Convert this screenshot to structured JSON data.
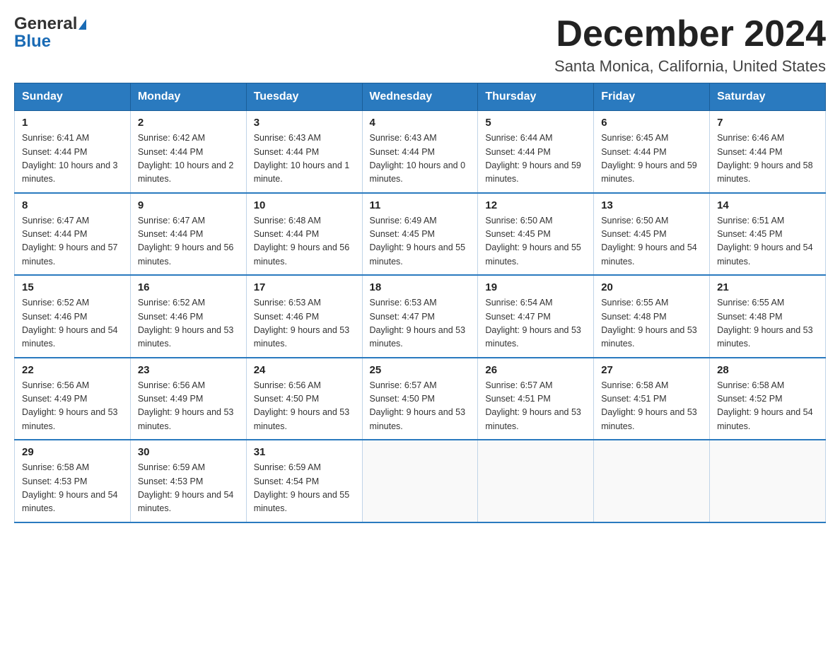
{
  "header": {
    "logo_line1": "General",
    "logo_line2": "Blue",
    "title": "December 2024",
    "subtitle": "Santa Monica, California, United States"
  },
  "days_of_week": [
    "Sunday",
    "Monday",
    "Tuesday",
    "Wednesday",
    "Thursday",
    "Friday",
    "Saturday"
  ],
  "weeks": [
    [
      {
        "day": "1",
        "sunrise": "6:41 AM",
        "sunset": "4:44 PM",
        "daylight": "10 hours and 3 minutes."
      },
      {
        "day": "2",
        "sunrise": "6:42 AM",
        "sunset": "4:44 PM",
        "daylight": "10 hours and 2 minutes."
      },
      {
        "day": "3",
        "sunrise": "6:43 AM",
        "sunset": "4:44 PM",
        "daylight": "10 hours and 1 minute."
      },
      {
        "day": "4",
        "sunrise": "6:43 AM",
        "sunset": "4:44 PM",
        "daylight": "10 hours and 0 minutes."
      },
      {
        "day": "5",
        "sunrise": "6:44 AM",
        "sunset": "4:44 PM",
        "daylight": "9 hours and 59 minutes."
      },
      {
        "day": "6",
        "sunrise": "6:45 AM",
        "sunset": "4:44 PM",
        "daylight": "9 hours and 59 minutes."
      },
      {
        "day": "7",
        "sunrise": "6:46 AM",
        "sunset": "4:44 PM",
        "daylight": "9 hours and 58 minutes."
      }
    ],
    [
      {
        "day": "8",
        "sunrise": "6:47 AM",
        "sunset": "4:44 PM",
        "daylight": "9 hours and 57 minutes."
      },
      {
        "day": "9",
        "sunrise": "6:47 AM",
        "sunset": "4:44 PM",
        "daylight": "9 hours and 56 minutes."
      },
      {
        "day": "10",
        "sunrise": "6:48 AM",
        "sunset": "4:44 PM",
        "daylight": "9 hours and 56 minutes."
      },
      {
        "day": "11",
        "sunrise": "6:49 AM",
        "sunset": "4:45 PM",
        "daylight": "9 hours and 55 minutes."
      },
      {
        "day": "12",
        "sunrise": "6:50 AM",
        "sunset": "4:45 PM",
        "daylight": "9 hours and 55 minutes."
      },
      {
        "day": "13",
        "sunrise": "6:50 AM",
        "sunset": "4:45 PM",
        "daylight": "9 hours and 54 minutes."
      },
      {
        "day": "14",
        "sunrise": "6:51 AM",
        "sunset": "4:45 PM",
        "daylight": "9 hours and 54 minutes."
      }
    ],
    [
      {
        "day": "15",
        "sunrise": "6:52 AM",
        "sunset": "4:46 PM",
        "daylight": "9 hours and 54 minutes."
      },
      {
        "day": "16",
        "sunrise": "6:52 AM",
        "sunset": "4:46 PM",
        "daylight": "9 hours and 53 minutes."
      },
      {
        "day": "17",
        "sunrise": "6:53 AM",
        "sunset": "4:46 PM",
        "daylight": "9 hours and 53 minutes."
      },
      {
        "day": "18",
        "sunrise": "6:53 AM",
        "sunset": "4:47 PM",
        "daylight": "9 hours and 53 minutes."
      },
      {
        "day": "19",
        "sunrise": "6:54 AM",
        "sunset": "4:47 PM",
        "daylight": "9 hours and 53 minutes."
      },
      {
        "day": "20",
        "sunrise": "6:55 AM",
        "sunset": "4:48 PM",
        "daylight": "9 hours and 53 minutes."
      },
      {
        "day": "21",
        "sunrise": "6:55 AM",
        "sunset": "4:48 PM",
        "daylight": "9 hours and 53 minutes."
      }
    ],
    [
      {
        "day": "22",
        "sunrise": "6:56 AM",
        "sunset": "4:49 PM",
        "daylight": "9 hours and 53 minutes."
      },
      {
        "day": "23",
        "sunrise": "6:56 AM",
        "sunset": "4:49 PM",
        "daylight": "9 hours and 53 minutes."
      },
      {
        "day": "24",
        "sunrise": "6:56 AM",
        "sunset": "4:50 PM",
        "daylight": "9 hours and 53 minutes."
      },
      {
        "day": "25",
        "sunrise": "6:57 AM",
        "sunset": "4:50 PM",
        "daylight": "9 hours and 53 minutes."
      },
      {
        "day": "26",
        "sunrise": "6:57 AM",
        "sunset": "4:51 PM",
        "daylight": "9 hours and 53 minutes."
      },
      {
        "day": "27",
        "sunrise": "6:58 AM",
        "sunset": "4:51 PM",
        "daylight": "9 hours and 53 minutes."
      },
      {
        "day": "28",
        "sunrise": "6:58 AM",
        "sunset": "4:52 PM",
        "daylight": "9 hours and 54 minutes."
      }
    ],
    [
      {
        "day": "29",
        "sunrise": "6:58 AM",
        "sunset": "4:53 PM",
        "daylight": "9 hours and 54 minutes."
      },
      {
        "day": "30",
        "sunrise": "6:59 AM",
        "sunset": "4:53 PM",
        "daylight": "9 hours and 54 minutes."
      },
      {
        "day": "31",
        "sunrise": "6:59 AM",
        "sunset": "4:54 PM",
        "daylight": "9 hours and 55 minutes."
      },
      null,
      null,
      null,
      null
    ]
  ]
}
